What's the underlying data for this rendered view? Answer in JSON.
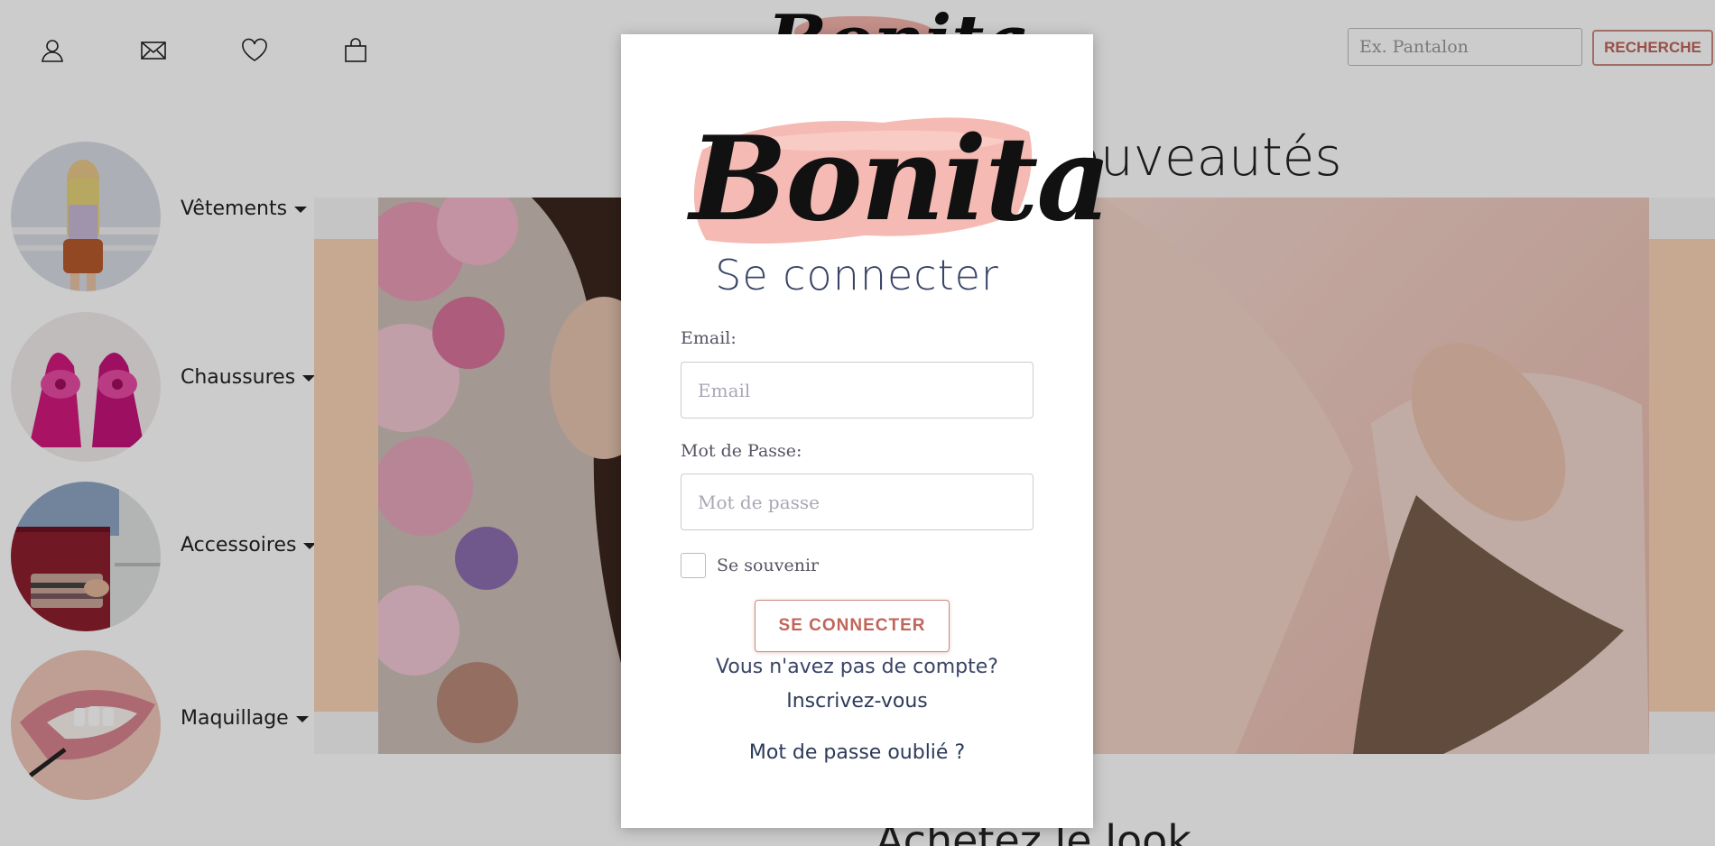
{
  "header": {
    "icons": [
      "user-icon",
      "mail-icon",
      "heart-icon",
      "bag-icon"
    ],
    "search_placeholder": "Ex. Pantalon",
    "search_button": "RECHERCHE",
    "logo_text": "Bonita"
  },
  "categories": [
    {
      "label": "Vêtements"
    },
    {
      "label": "Chaussures"
    },
    {
      "label": "Accessoires"
    },
    {
      "label": "Maquillage"
    }
  ],
  "main": {
    "section_title": "Nouveautés",
    "shop_title": "Achetez le look"
  },
  "modal": {
    "logo_text": "Bonita",
    "title": "Se connecter",
    "email_label": "Email:",
    "email_placeholder": "Email",
    "password_label": "Mot de Passe:",
    "password_placeholder": "Mot de passe",
    "remember_label": "Se souvenir",
    "submit_label": "SE CONNECTER",
    "no_account_text": "Vous n'avez pas de compte?",
    "register_link": "Inscrivez-vous",
    "forgot_link": "Mot de passe oublié ?"
  },
  "colors": {
    "accent": "#c0655a",
    "brush_pink": "#f4b3ac",
    "text_navy": "#3a4466",
    "band_peach": "#f9d2b6"
  }
}
